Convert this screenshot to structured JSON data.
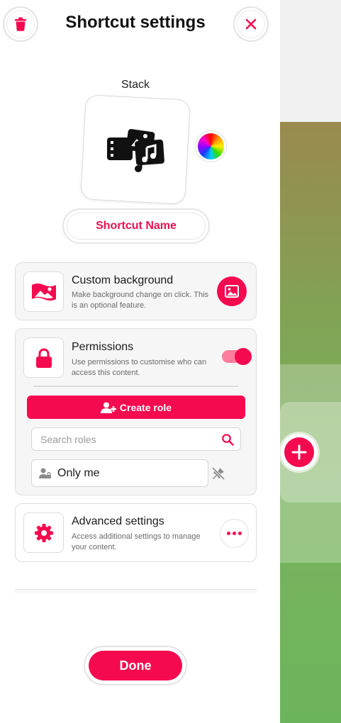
{
  "header": {
    "title": "Shortcut settings",
    "delete_icon": "trash-icon",
    "close_icon": "close-icon"
  },
  "shortcut": {
    "icon_label": "Stack",
    "icon_name": "media-stack-icon",
    "color_picker_icon": "color-wheel-icon",
    "name_button": "Shortcut Name"
  },
  "custom_background": {
    "title": "Custom background",
    "description": "Make background change on click. This is an optional feature.",
    "icon": "landscape-image-icon",
    "action_icon": "image-icon"
  },
  "permissions": {
    "title": "Permissions",
    "description": "Use permissions to customise who can access this content.",
    "icon": "lock-icon",
    "enabled": true,
    "create_role_label": "Create role",
    "search_placeholder": "Search roles",
    "roles": [
      {
        "label": "Only me",
        "icon": "user-lock-icon"
      }
    ],
    "unpin_icon": "unpin-icon"
  },
  "advanced": {
    "title": "Advanced settings",
    "description": "Access additional settings to manage your content.",
    "icon": "gear-icon",
    "action_icon": "more-icon"
  },
  "footer": {
    "done_label": "Done"
  },
  "colors": {
    "accent": "#f5094f",
    "toggle_track": "#ff7d9c"
  }
}
